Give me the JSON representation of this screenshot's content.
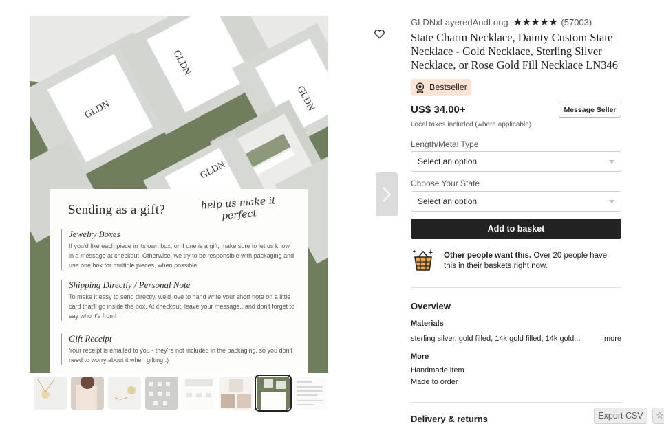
{
  "shop": {
    "name": "GLDNxLayeredAndLong",
    "stars": "★★★★★",
    "review_count": "(57003)"
  },
  "product": {
    "title": "State Charm Necklace, Dainty Custom State Necklace - Gold Necklace, Sterling Silver Necklace, or Rose Gold Fill Necklace LN346",
    "badge": "Bestseller",
    "price": "US$ 34.00+",
    "tax_note": "Local taxes included (where applicable)",
    "message_seller": "Message Seller"
  },
  "options": [
    {
      "label": "Length/Metal Type",
      "placeholder": "Select an option"
    },
    {
      "label": "Choose Your State",
      "placeholder": "Select an option"
    }
  ],
  "cart": {
    "add_label": "Add to basket",
    "demand_bold": "Other people want this.",
    "demand_rest": " Over 20 people have this in their baskets right now."
  },
  "overview": {
    "heading": "Overview",
    "materials_heading": "Materials",
    "materials_value": "sterling silver, gold filled, 14k gold filled, 14k gold...",
    "more_link": "more",
    "more_heading": "More",
    "details": [
      "Handmade item",
      "Made to order"
    ]
  },
  "delivery": {
    "heading": "Delivery & returns"
  },
  "image": {
    "gift_card": {
      "title": "Sending as a gift?",
      "script": "help us make it perfect",
      "sections": [
        {
          "heading": "Jewelry Boxes",
          "body": "If you'd like each piece in its own box, or if one is a gift, make sure to let us know in a message at checkout.  Otherwise, we try to be responsible with packaging and use one box for multiple pieces, when possible."
        },
        {
          "heading": "Shipping Directly / Personal Note",
          "body": "To make it easy to send directly, we'd love to hand write your short note on a little card that'll go inside the box.  At checkout, leave your message.. and don't forget to say who it's from!"
        },
        {
          "heading": "Gift Receipt",
          "body": "Your receipt is emailed to you - they're not included in the packaging, so you don't need to worry about it when gifting :)"
        }
      ]
    },
    "box_label": "GLDN",
    "thumbnail_count": 8,
    "selected_thumbnail": 7
  },
  "toolbar": {
    "export_label": "Export CSV",
    "star_icon": "star-icon"
  },
  "colors": {
    "primary_button": "#222222",
    "badge_bg": "#fbe4d4",
    "image_green": "#6f7f5c",
    "box_gray": "#d6d8d3"
  }
}
